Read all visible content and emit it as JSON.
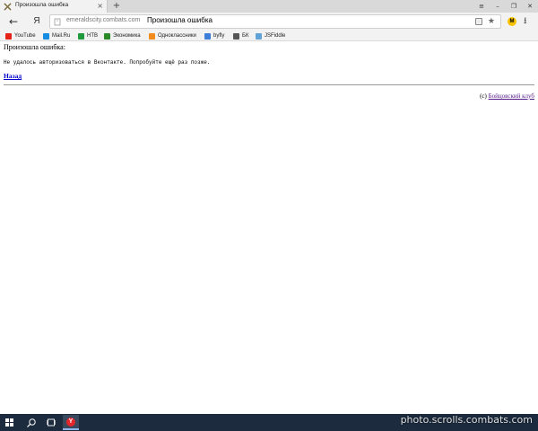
{
  "tab": {
    "title": "Произошла ошибка",
    "close_glyph": "×",
    "new_tab_glyph": "+"
  },
  "window_controls": {
    "menu_glyph": "≡",
    "minimize_glyph": "–",
    "restore_glyph": "❐",
    "close_glyph": "✕"
  },
  "toolbar": {
    "back_glyph": "←",
    "yandex_glyph": "Я",
    "url_domain": "emeraldscity.combats.com",
    "page_title": "Произошла ошибка",
    "bookmark_glyph": "★",
    "avatar_letter": "M",
    "download_glyph": "⭳"
  },
  "bookmarks": [
    {
      "label": "YouTube",
      "icon": "youtube-icon",
      "color": "#e62117"
    },
    {
      "label": "Mail.Ru",
      "icon": "mailru-icon",
      "color": "#168de2"
    },
    {
      "label": "НТВ",
      "icon": "ntv-icon",
      "color": "#1f9a3c"
    },
    {
      "label": "Экономика",
      "icon": "economy-icon",
      "color": "#2a8a2a"
    },
    {
      "label": "Одноклассники",
      "icon": "odnoklassniki-icon",
      "color": "#f28a1c"
    },
    {
      "label": "byfly",
      "icon": "byfly-icon",
      "color": "#3c7ed8"
    },
    {
      "label": "БК",
      "icon": "bk-icon",
      "color": "#555555"
    },
    {
      "label": "JSFiddle",
      "icon": "jsfiddle-icon",
      "color": "#5fa3d8"
    }
  ],
  "page": {
    "heading": "Произошла ошибка:",
    "message": "Не удалось авторизоваться в Вконтакте. Попробуйте ещё раз позже.",
    "back_link": "Назад",
    "footer_prefix": "(c) ",
    "footer_link": "Бойцовский клуб"
  },
  "taskbar": {
    "browser_letter": "Y",
    "clock": ""
  },
  "watermark": "photo.scrolls.combats.com"
}
